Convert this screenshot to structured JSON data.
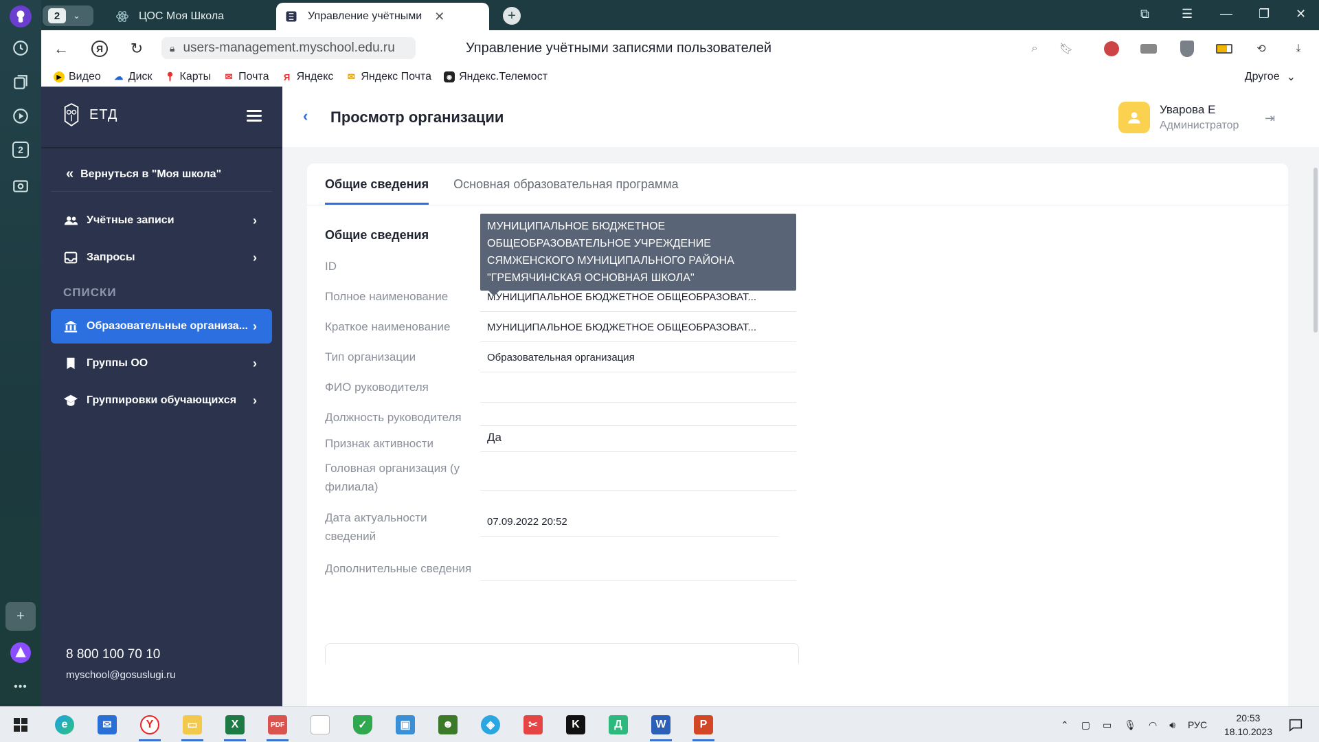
{
  "browser": {
    "tab_count": "2",
    "tabs": [
      {
        "label": "ЦОС Моя Школа"
      },
      {
        "label": "Управление учётными"
      }
    ],
    "url": "users-management.myschool.edu.ru",
    "page_title": "Управление учётными записями пользователей",
    "bookmarks": [
      {
        "label": "Видео",
        "icon": "video-icon"
      },
      {
        "label": "Диск",
        "icon": "disk-icon"
      },
      {
        "label": "Карты",
        "icon": "maps-icon"
      },
      {
        "label": "Почта",
        "icon": "mail-icon"
      },
      {
        "label": "Яндекс",
        "icon": "yandex-icon"
      },
      {
        "label": "Яндекс Почта",
        "icon": "mail-icon"
      },
      {
        "label": "Яндекс.Телемост",
        "icon": "telemost-icon"
      }
    ],
    "bookmarks_other": "Другое",
    "rail_badge": "2"
  },
  "app": {
    "brand": "ЕТД",
    "back_link": "Вернуться в \"Моя школа\"",
    "nav": [
      {
        "label": "Учётные записи",
        "icon": "users-icon"
      },
      {
        "label": "Запросы",
        "icon": "inbox-icon"
      }
    ],
    "section_label": "СПИСКИ",
    "lists": [
      {
        "label": "Образовательные организа...",
        "icon": "institution-icon",
        "active": true
      },
      {
        "label": "Группы ОО",
        "icon": "bookmark-icon"
      },
      {
        "label": "Группировки обучающихся",
        "icon": "graduation-icon"
      }
    ],
    "contacts": {
      "phone": "8 800 100 70 10",
      "email": "myschool@gosuslugi.ru"
    }
  },
  "header": {
    "title": "Просмотр организации",
    "user_name": "Уварова Е",
    "user_role": "Администратор"
  },
  "tabs": [
    {
      "label": "Общие сведения",
      "active": true
    },
    {
      "label": "Основная образовательная программа",
      "active": false
    }
  ],
  "section_title": "Общие сведения",
  "fields": [
    {
      "label": "ID",
      "value": ""
    },
    {
      "label": "Полное наименование",
      "value": "МУНИЦИПАЛЬНОЕ БЮДЖЕТНОЕ ОБЩЕОБРАЗОВАТ..."
    },
    {
      "label": "Краткое наименование",
      "value": "МУНИЦИПАЛЬНОЕ БЮДЖЕТНОЕ ОБЩЕОБРАЗОВАТ..."
    },
    {
      "label": "Тип организации",
      "value": "Образовательная организация"
    },
    {
      "label": "ФИО руководителя",
      "value": ""
    },
    {
      "label": "Должность руководителя",
      "value": ""
    },
    {
      "label": "Признак активности",
      "value": "Да"
    },
    {
      "label": "Головная организация (у филиала)",
      "value": ""
    },
    {
      "label": "Дата актуальности сведений",
      "value": "07.09.2022 20:52"
    },
    {
      "label": "Дополнительные сведения",
      "value": ""
    }
  ],
  "tooltip": "МУНИЦИПАЛЬНОЕ БЮДЖЕТНОЕ ОБЩЕОБРАЗОВАТЕЛЬНОЕ УЧРЕЖДЕНИЕ СЯМЖЕНСКОГО МУНИЦИПАЛЬНОГО РАЙОНА \"ГРЕМЯЧИНСКАЯ ОСНОВНАЯ ШКОЛА\"",
  "taskbar": {
    "lang": "РУС",
    "time": "20:53",
    "date": "18.10.2023"
  }
}
